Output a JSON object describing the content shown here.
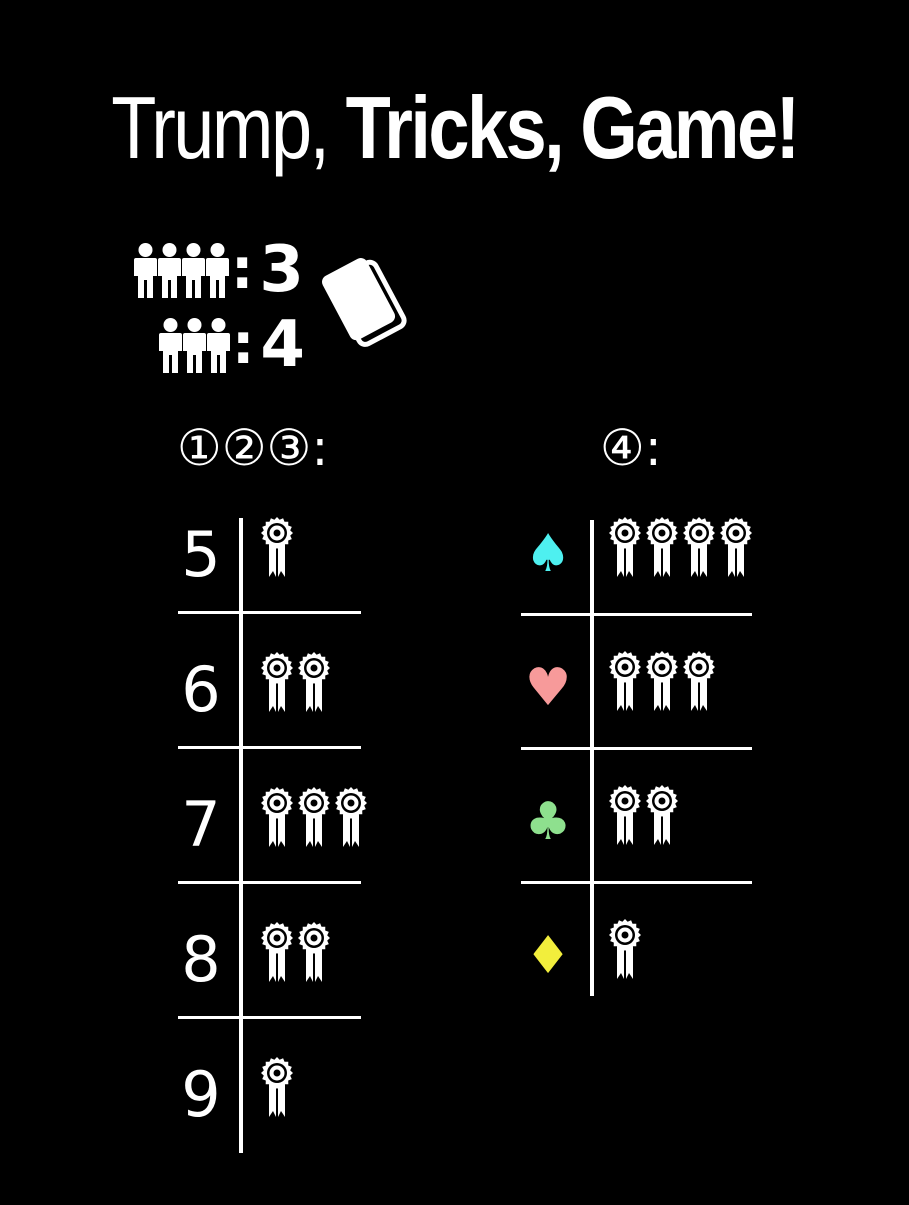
{
  "title": {
    "part1": "Trump, ",
    "part2": "Tricks, ",
    "part3": "Game!"
  },
  "players": [
    {
      "count": "3",
      "colon": ":",
      "people": 4
    },
    {
      "count": "4",
      "colon": ":",
      "people": 3
    }
  ],
  "deck_icon": "card-deck-icon",
  "left_column": {
    "header": "①②③:",
    "rows": [
      {
        "label": "5",
        "ribbons": 1
      },
      {
        "label": "6",
        "ribbons": 2
      },
      {
        "label": "7",
        "ribbons": 3
      },
      {
        "label": "8",
        "ribbons": 2
      },
      {
        "label": "9",
        "ribbons": 1
      }
    ]
  },
  "right_column": {
    "header": "④:",
    "rows": [
      {
        "suit": "♠",
        "suit_name": "spade",
        "color": "#4ef0f0",
        "ribbons": 4
      },
      {
        "suit": "♥",
        "suit_name": "heart",
        "color": "#f79a9a",
        "ribbons": 3
      },
      {
        "suit": "♣",
        "suit_name": "club",
        "color": "#8ee08e",
        "ribbons": 2
      },
      {
        "suit": "♦",
        "suit_name": "diamond",
        "color": "#f2ee3c",
        "ribbons": 1
      }
    ]
  },
  "icons": {
    "person": "person-icon",
    "ribbon": "award-ribbon-icon"
  }
}
